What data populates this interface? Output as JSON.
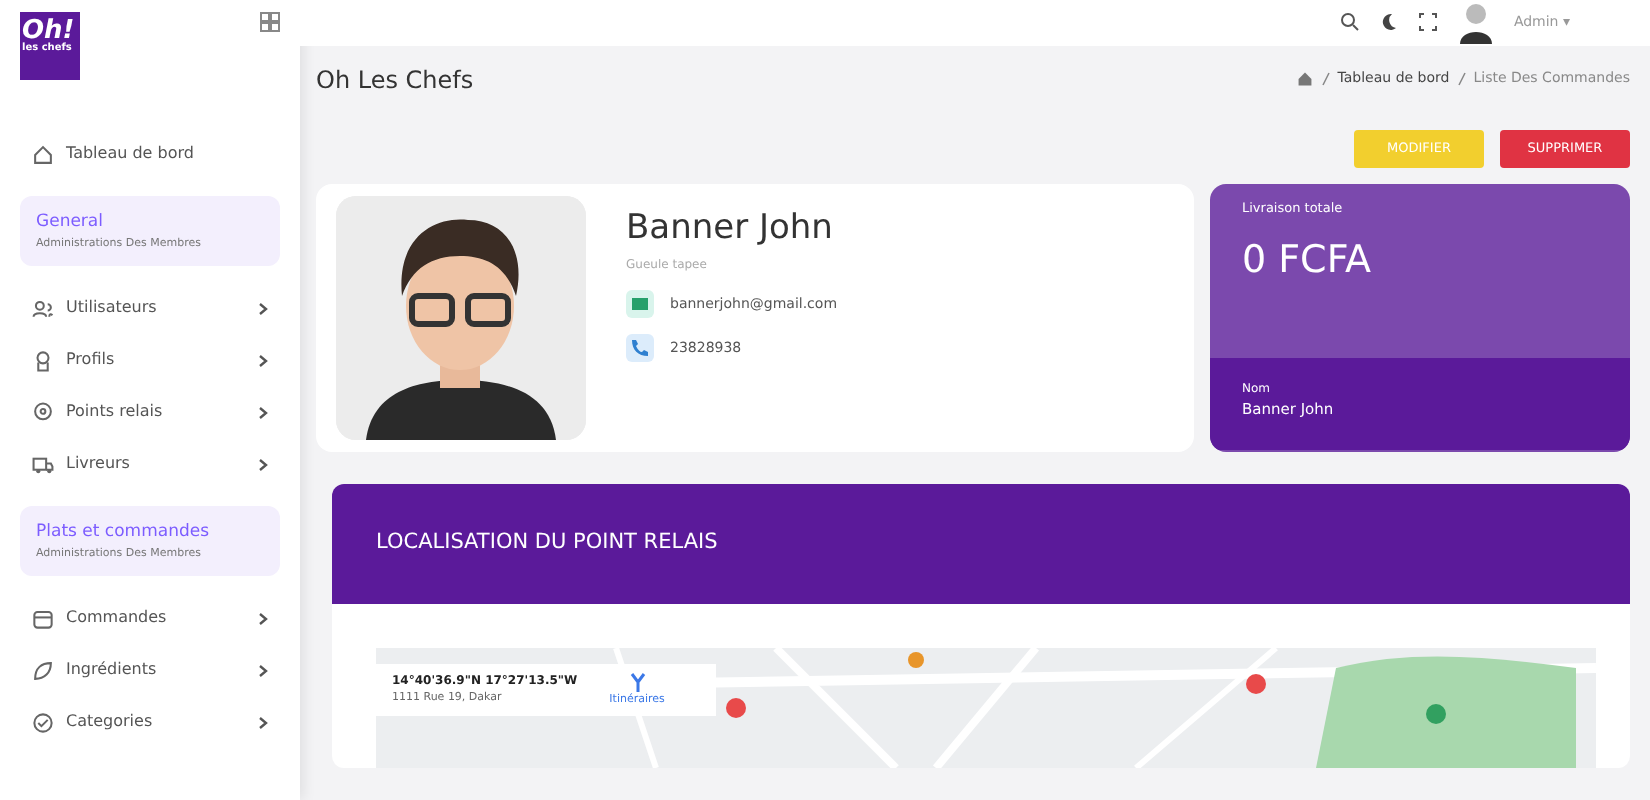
{
  "brand": {
    "logo": "Oh!",
    "tagline": "les chefs"
  },
  "sidebar": {
    "items": [
      {
        "kind": "link",
        "label": "Tableau de bord"
      },
      {
        "kind": "section",
        "label": "General",
        "sub": "Administrations Des Membres"
      },
      {
        "kind": "menu",
        "label": "Utilisateurs"
      },
      {
        "kind": "menu",
        "label": "Profils"
      },
      {
        "kind": "menu",
        "label": "Points relais"
      },
      {
        "kind": "menu",
        "label": "Livreurs"
      },
      {
        "kind": "section",
        "label": "Plats et commandes",
        "sub": "Administrations Des Membres"
      },
      {
        "kind": "menu",
        "label": "Commandes"
      },
      {
        "kind": "menu",
        "label": "Ingrédients"
      },
      {
        "kind": "menu",
        "label": "Categories"
      }
    ]
  },
  "topbar": {
    "role": "Admin ▾"
  },
  "page": {
    "title": "Oh Les Chefs",
    "breadcrumb": [
      "Tableau de bord",
      "Liste Des Commandes"
    ]
  },
  "actions": [
    {
      "label": "MODIFIER",
      "kind": "warning"
    },
    {
      "label": "SUPPRIMER",
      "kind": "danger"
    }
  ],
  "profile": {
    "name": "Banner John",
    "address": "Gueule tapee",
    "email": "bannerjohn@gmail.com",
    "phone": "23828938"
  },
  "stats": {
    "label": "Livraison totale",
    "value": "0 FCFA",
    "name_label": "Nom",
    "name": "Banner John"
  },
  "map_section": {
    "title": "LOCALISATION DU POINT RELAIS",
    "coords": "14°40'36.9\"N 17°27'13.5\"W",
    "address": "1111 Rue 19, Dakar",
    "directions": "Itinéraires"
  }
}
